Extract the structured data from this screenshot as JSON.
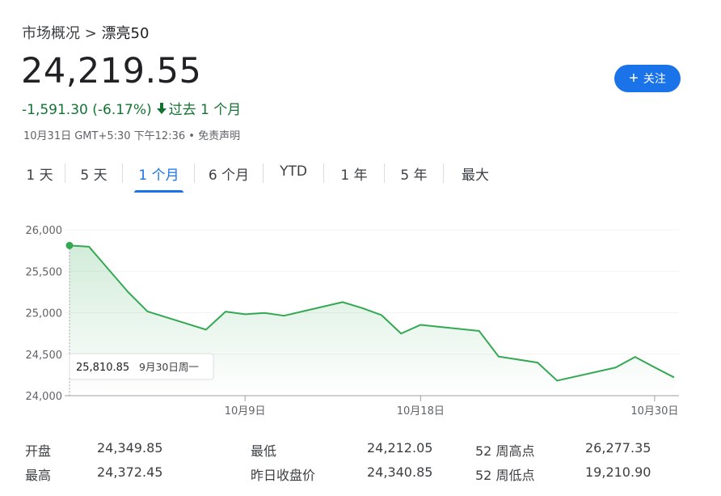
{
  "breadcrumb": {
    "parent": "市场概况",
    "separator": ">",
    "current": "漂亮50"
  },
  "quote": {
    "price": "24,219.55",
    "change": "-1,591.30 (-6.17%)",
    "change_period": "过去 1 个月",
    "change_direction": "down",
    "timestamp": "10月31日 GMT+5:30 下午12:36",
    "disclaimer": "免责声明"
  },
  "follow_button": {
    "label": "关注",
    "icon": "plus-icon"
  },
  "range_tabs": [
    "1 天",
    "5 天",
    "1 个月",
    "6 个月",
    "YTD",
    "1 年",
    "5 年",
    "最大"
  ],
  "selected_tab": "1 个月",
  "tooltip": {
    "value": "25,810.85",
    "date": "9月30日周一"
  },
  "colors": {
    "accent": "#1a73e8",
    "down": "#137333",
    "line": "#34a853"
  },
  "chart_data": {
    "type": "area",
    "x_ticks": [
      "10月9日",
      "10月18日",
      "10月30日"
    ],
    "y_ticks": [
      "26,000",
      "25,500",
      "25,000",
      "24,500",
      "24,000"
    ],
    "ylim": [
      24000,
      26000
    ],
    "grid": true,
    "points": [
      {
        "x": "9月30日",
        "y": 25810.85
      },
      {
        "x": "10月1日",
        "y": 25796
      },
      {
        "x": "10月3日",
        "y": 25250
      },
      {
        "x": "10月4日",
        "y": 25015
      },
      {
        "x": "10月7日",
        "y": 24796
      },
      {
        "x": "10月8日",
        "y": 25013
      },
      {
        "x": "10月9日",
        "y": 24982
      },
      {
        "x": "10月10日",
        "y": 24998
      },
      {
        "x": "10月11日",
        "y": 24964
      },
      {
        "x": "10月14日",
        "y": 25128
      },
      {
        "x": "10月15日",
        "y": 25057
      },
      {
        "x": "10月16日",
        "y": 24971
      },
      {
        "x": "10月17日",
        "y": 24749
      },
      {
        "x": "10月18日",
        "y": 24854
      },
      {
        "x": "10月21日",
        "y": 24781
      },
      {
        "x": "10月22日",
        "y": 24472
      },
      {
        "x": "10月24日",
        "y": 24399
      },
      {
        "x": "10月25日",
        "y": 24181
      },
      {
        "x": "10月28日",
        "y": 24339
      },
      {
        "x": "10月29日",
        "y": 24467
      },
      {
        "x": "10月30日",
        "y": 24341
      },
      {
        "x": "10月31日",
        "y": 24220
      }
    ]
  },
  "stats": {
    "open_label": "开盘",
    "open": "24,349.85",
    "high_label": "最高",
    "high": "24,372.45",
    "low_label": "最低",
    "low": "24,212.05",
    "prev_close_label": "昨日收盘价",
    "prev_close": "24,340.85",
    "wk52_high_label": "52 周高点",
    "wk52_high": "26,277.35",
    "wk52_low_label": "52 周低点",
    "wk52_low": "19,210.90"
  }
}
